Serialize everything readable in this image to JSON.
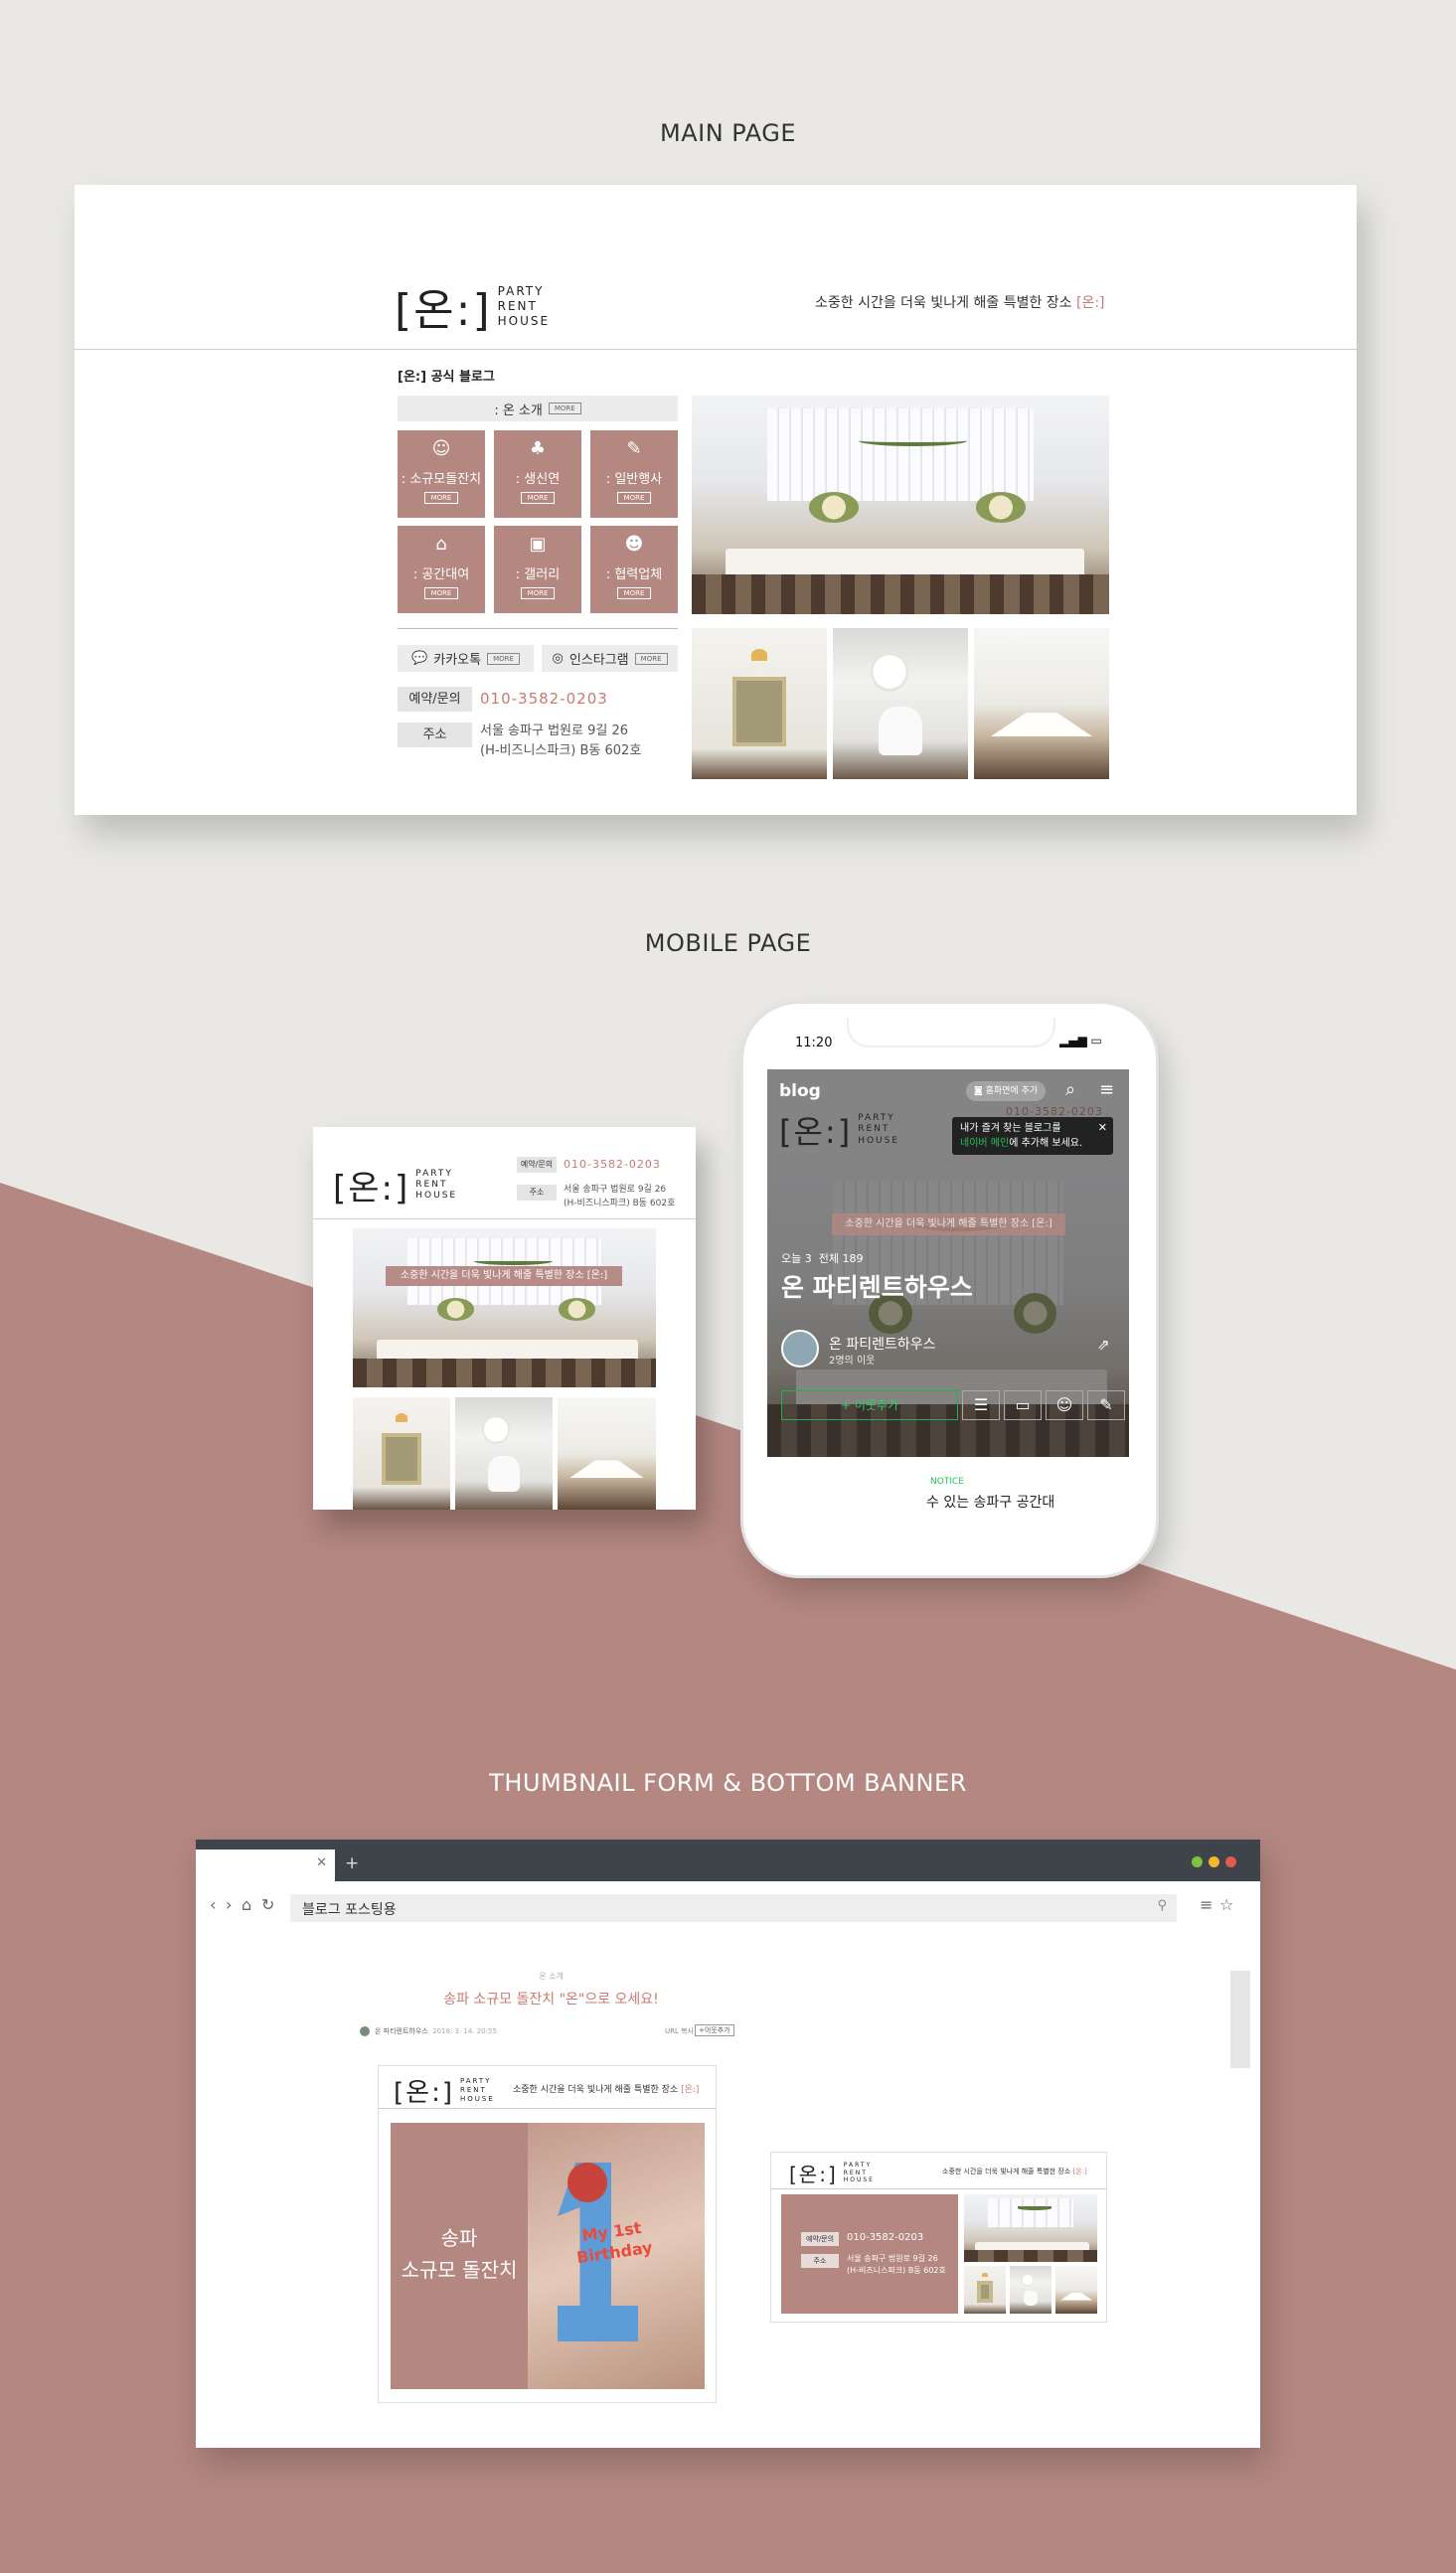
{
  "colors": {
    "background": "#e9e8e4",
    "accent": "#b48781",
    "accent_text": "#c97a70",
    "browser_bar": "#3f444b"
  },
  "sections": {
    "main_title": "MAIN PAGE",
    "mobile_title": "MOBILE PAGE",
    "thumbnail_title": "THUMBNAIL FORM & BOTTOM BANNER"
  },
  "brand": {
    "mark": "[온:]",
    "line1": "PARTY",
    "line2": "RENT",
    "line3": "HOUSE"
  },
  "tagline": {
    "text": "소중한 시간을 더욱 빛나게 해줄 특별한 장소 ",
    "accent": "[온:]"
  },
  "main": {
    "blog_title": "[온:] 공식 블로그",
    "intro_label": ": 온 소개",
    "more": "MORE",
    "tiles": [
      {
        "icon": "☺",
        "label": ": 소규모돌잔치"
      },
      {
        "icon": "♣",
        "label": ": 생신연"
      },
      {
        "icon": "✎",
        "label": ": 일반행사"
      },
      {
        "icon": "⌂",
        "label": ": 공간대여"
      },
      {
        "icon": "▣",
        "label": ": 갤러리"
      },
      {
        "icon": "☻",
        "label": ": 협력업체"
      }
    ],
    "kakao": "카카오톡",
    "instagram": "인스타그램",
    "reserve_label": "예약/문의",
    "phone": "010-3582-0203",
    "addr_label": "주소",
    "addr_line1": "서울 송파구 법원로 9길 26",
    "addr_line2": "(H-비즈니스파크) B동 602호"
  },
  "mobile": {
    "reserve_label": "예약/문의",
    "phone": "010-3582-0203",
    "addr_label": "주소",
    "addr_line1": "서울 송파구 법원로 9길 26",
    "addr_line2": "(H-비즈니스파크) B동 602호",
    "overlay": "소중한 시간을 더욱 빛나게 해줄 특별한 장소 [온:]"
  },
  "phone": {
    "time": "11:20",
    "blog": "blog",
    "add_home": "홈화면에 추가",
    "tooltip_line1": "내가 즐겨 찾는 블로그를",
    "tooltip_line2_a": "네이버 메인",
    "tooltip_line2_b": "에 추가해 보세요.",
    "phone_peek": "010-3582-0203",
    "overlay": "소중한 시간을 더욱 빛나게 해줄 특별한 장소 [온:]",
    "today": "오늘 3",
    "total": "전체 189",
    "blog_name": "온 파티렌트하우스",
    "profile_name": "온 파티렌트하우스",
    "neighbors": "2명의 이웃",
    "add_neighbor": "+ 이웃추가",
    "notice": "NOTICE",
    "notice_text": "수 있는 송파구 공간대"
  },
  "browser": {
    "address": "블로그 포스팅용",
    "category": "온 소개",
    "post_title": "송파 소규모 돌잔치 \"온\"으로 오세요!",
    "author": "온 파티렌트하우스",
    "date": "2018. 3. 14. 20:55",
    "url_label": "URL 복사",
    "neighbor_btn": "+이웃추가",
    "thumb_line1": "송파",
    "thumb_line2": "소규모 돌잔치",
    "candle_text": "My 1st Birthday",
    "banner_reserve": "예약/문의",
    "banner_phone": "010-3582-0203",
    "banner_addr_label": "주소",
    "banner_addr1": "서울 송파구 법원로 9길 26",
    "banner_addr2": "(H-비즈니스파크) B동 602호"
  }
}
